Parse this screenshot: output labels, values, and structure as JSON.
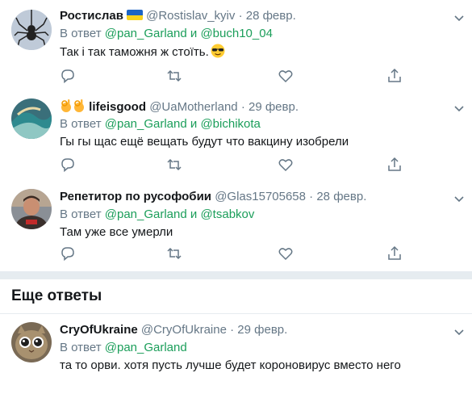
{
  "tweets": [
    {
      "name": "Ростислав",
      "handle": "@Rostislav_kyiv",
      "separator": "·",
      "date": "28 февр.",
      "reply_prefix": "В ответ",
      "reply_user1": "@pan_Garland",
      "reply_and": "и",
      "reply_user2": "@buch10_04",
      "text": "Так і так таможня ж стоїть.",
      "emoji": "smiling-face-with-sunglasses"
    },
    {
      "name": "lifeisgood",
      "handle": "@UaMotherland",
      "separator": "·",
      "date": "29 февр.",
      "reply_prefix": "В ответ",
      "reply_user1": "@pan_Garland",
      "reply_and": "и",
      "reply_user2": "@bichikota",
      "text": "Гы гы щас ещё вещать будут что вакцину изобрели"
    },
    {
      "name": "Репетитор по русофобии",
      "handle": "@Glas15705658",
      "separator": "·",
      "date": "28 февр.",
      "reply_prefix": "В ответ",
      "reply_user1": "@pan_Garland",
      "reply_and": "и",
      "reply_user2": "@tsabkov",
      "text": "Там уже все умерли"
    },
    {
      "name": "CryOfUkraine",
      "handle": "@CryOfUkraine",
      "separator": "·",
      "date": "29 февр.",
      "reply_prefix": "В ответ",
      "reply_user1": "@pan_Garland",
      "text": "та то орви. хотя пусть лучше будет короновирус вместо него"
    }
  ],
  "section": {
    "title": "Еще ответы"
  },
  "colors": {
    "link": "#1b9e5a",
    "secondary_text": "#657786",
    "divider": "#e6ecf0"
  }
}
